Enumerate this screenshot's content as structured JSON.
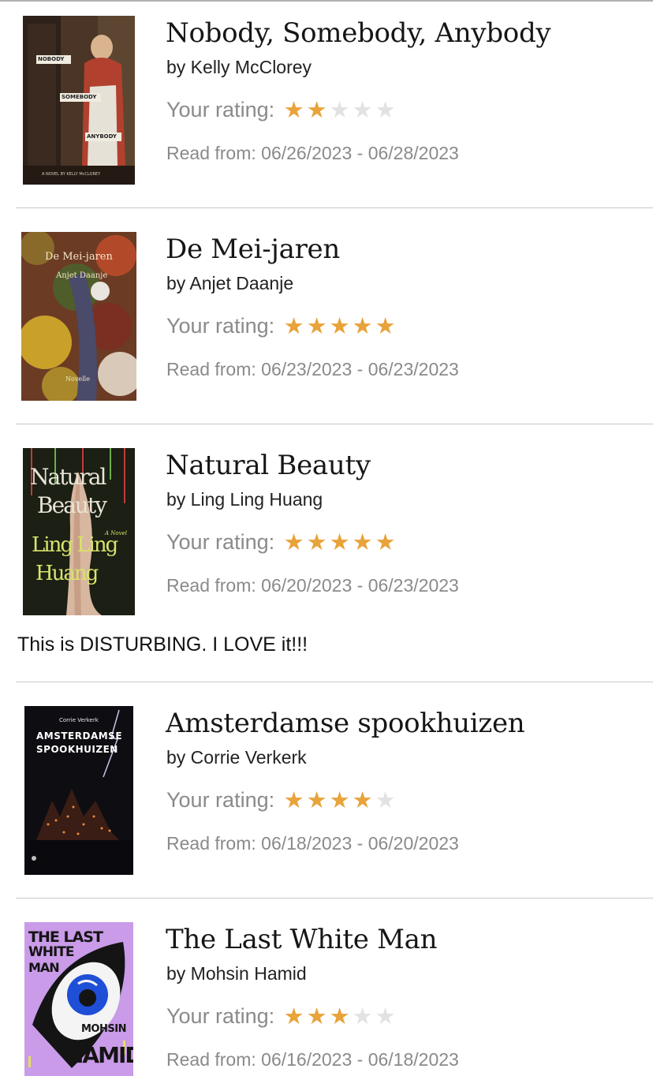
{
  "rating_label": "Your rating:",
  "books": [
    {
      "title": "Nobody, Somebody, Anybody",
      "author": "by Kelly McClorey",
      "rating": 2,
      "max_rating": 5,
      "read_dates": "Read from: 06/26/2023 - 06/28/2023",
      "cover_text": [
        "NOBODY",
        "SOMEBODY",
        "ANYBODY",
        "A NOVEL BY KELLY McCLOREY"
      ]
    },
    {
      "title": "De Mei-jaren",
      "author": "by Anjet Daanje",
      "rating": 5,
      "max_rating": 5,
      "read_dates": "Read from: 06/23/2023 - 06/23/2023",
      "cover_text": [
        "De Mei-jaren",
        "Anjet Daanje",
        "Novelle"
      ]
    },
    {
      "title": "Natural Beauty",
      "author": "by Ling Ling Huang",
      "rating": 5,
      "max_rating": 5,
      "read_dates": "Read from: 06/20/2023 - 06/23/2023",
      "review": "This is DISTURBING. I LOVE it!!!",
      "cover_text": [
        "Natural",
        "Beauty",
        "Ling Ling",
        "Huang",
        "A Novel"
      ]
    },
    {
      "title": "Amsterdamse spookhuizen",
      "author": "by Corrie Verkerk",
      "rating": 4,
      "max_rating": 5,
      "read_dates": "Read from: 06/18/2023 - 06/20/2023",
      "cover_text": [
        "Corrie Verkerk",
        "AMSTERDAMSE",
        "SPOOKHUIZEN"
      ]
    },
    {
      "title": "The Last White Man",
      "author": "by Mohsin Hamid",
      "rating": 3,
      "max_rating": 5,
      "read_dates": "Read from: 06/16/2023 - 06/18/2023",
      "cover_text": [
        "THE LAST",
        "WHITE",
        "MAN",
        "MOHSIN",
        "HAMID"
      ]
    }
  ],
  "colors": {
    "star_on": "#E8A33A",
    "star_off": "#E2E2E2",
    "muted_text": "#8A8A8A"
  }
}
